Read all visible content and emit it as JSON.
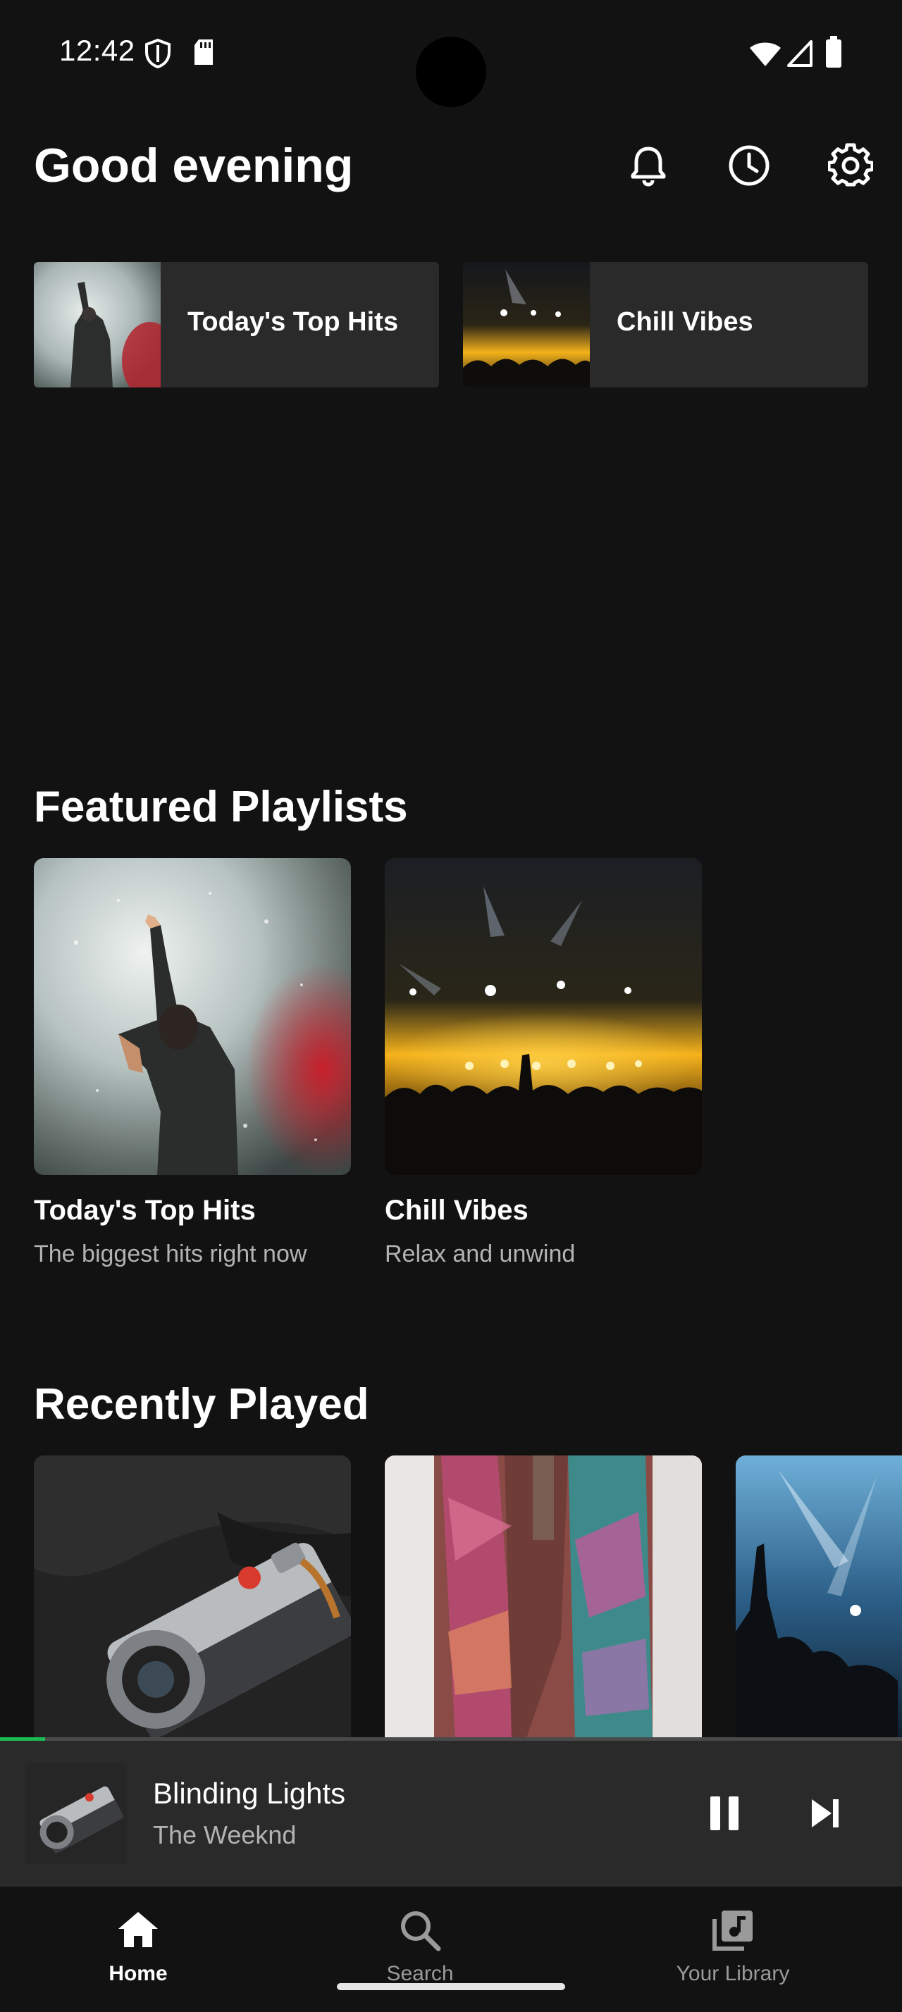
{
  "status_bar": {
    "time": "12:42"
  },
  "header": {
    "greeting": "Good evening"
  },
  "quick_tiles": [
    {
      "label": "Today's Top Hits"
    },
    {
      "label": "Chill Vibes"
    }
  ],
  "featured": {
    "title": "Featured Playlists",
    "items": [
      {
        "title": "Today's Top Hits",
        "subtitle": "The biggest hits right now"
      },
      {
        "title": "Chill Vibes",
        "subtitle": "Relax and unwind"
      }
    ]
  },
  "recent": {
    "title": "Recently Played"
  },
  "player": {
    "track": "Blinding Lights",
    "artist": "The Weeknd",
    "progress": 0.05,
    "accent": "#1db954"
  },
  "nav": {
    "items": [
      {
        "label": "Home",
        "icon": "home-icon",
        "active": true
      },
      {
        "label": "Search",
        "icon": "search-icon",
        "active": false
      },
      {
        "label": "Your Library",
        "icon": "library-icon",
        "active": false
      }
    ]
  }
}
